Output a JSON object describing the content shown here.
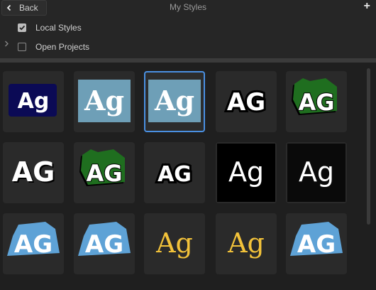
{
  "header": {
    "back_label": "Back",
    "title": "My Styles"
  },
  "filters": [
    {
      "label": "Local Styles",
      "checked": true
    },
    {
      "label": "Open Projects",
      "checked": false
    }
  ],
  "tiles": [
    {
      "text": "Ag",
      "style": "white-on-navy"
    },
    {
      "text": "Ag",
      "style": "white-serif-on-steelblue"
    },
    {
      "text": "Ag",
      "style": "white-serif-on-steelblue",
      "selected": true
    },
    {
      "text": "AG",
      "style": "white-black-outline"
    },
    {
      "text": "AG",
      "style": "white-on-green-blob"
    },
    {
      "text": "AG",
      "style": "white-black-shadow"
    },
    {
      "text": "AG",
      "style": "white-on-green-blob"
    },
    {
      "text": "AG",
      "style": "white-black-outline-wide"
    },
    {
      "text": "Ag",
      "style": "white-on-black"
    },
    {
      "text": "Ag",
      "style": "white-outline-on-black"
    },
    {
      "text": "AG",
      "style": "white-on-blue-blob"
    },
    {
      "text": "AG",
      "style": "white-on-blue-blob"
    },
    {
      "text": "Ag",
      "style": "gold-serif"
    },
    {
      "text": "Ag",
      "style": "gold-serif"
    },
    {
      "text": "AG",
      "style": "white-on-blue-blob"
    }
  ],
  "colors": {
    "selected_border": "#4a90e2",
    "navy": "#0b0a55",
    "steelblue": "#6e9fb7",
    "green": "#1f6e1f",
    "blue_blob": "#5ea2d6",
    "gold": "#f2c23a"
  }
}
